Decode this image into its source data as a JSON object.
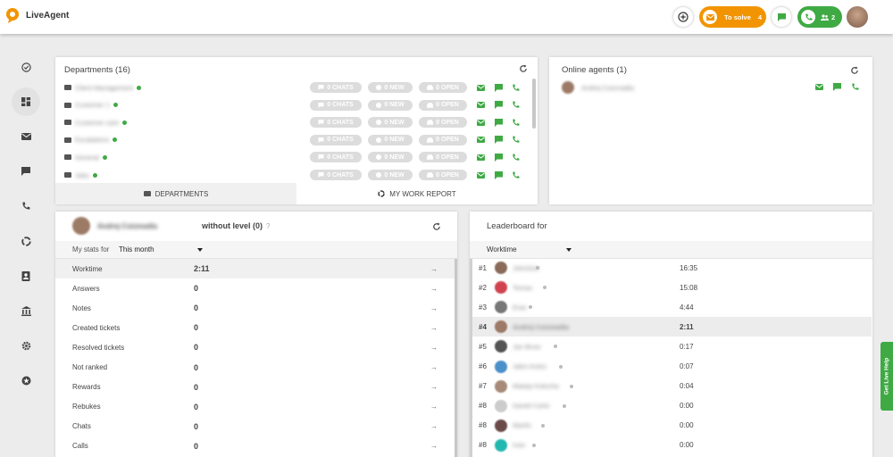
{
  "app": {
    "logo_text": "LiveAgent"
  },
  "topbar": {
    "to_solve_label": "To solve",
    "to_solve_count": "4",
    "calls_count": "2"
  },
  "colors": {
    "accent_orange": "#f29400",
    "accent_green": "#3faa44",
    "pill_gray": "#dcdcdc"
  },
  "sidebar": {
    "items": [
      {
        "icon": "check-circle-icon"
      },
      {
        "icon": "dashboard-icon",
        "active": true
      },
      {
        "icon": "mail-icon"
      },
      {
        "icon": "chat-icon"
      },
      {
        "icon": "phone-icon"
      },
      {
        "icon": "reports-icon"
      },
      {
        "icon": "contacts-icon"
      },
      {
        "icon": "bank-icon"
      },
      {
        "icon": "settings-icon"
      },
      {
        "icon": "plugins-icon"
      }
    ]
  },
  "departments": {
    "title": "Departments (16)",
    "rows": [
      {
        "name": "Client Management",
        "chats": "0 CHATS",
        "new": "0 NEW",
        "open": "0 OPEN"
      },
      {
        "name": "Customer 1",
        "chats": "0 CHATS",
        "new": "0 NEW",
        "open": "0 OPEN"
      },
      {
        "name": "Customer care",
        "chats": "0 CHATS",
        "new": "0 NEW",
        "open": "0 OPEN"
      },
      {
        "name": "Escalations",
        "chats": "0 CHATS",
        "new": "0 NEW",
        "open": "0 OPEN"
      },
      {
        "name": "General",
        "chats": "0 CHATS",
        "new": "0 NEW",
        "open": "0 OPEN"
      },
      {
        "name": "Jobs",
        "chats": "0 CHATS",
        "new": "0 NEW",
        "open": "0 OPEN"
      }
    ],
    "tab_departments": "DEPARTMENTS",
    "tab_report": "MY WORK REPORT"
  },
  "online_agents": {
    "title": "Online agents (1)",
    "agents": [
      {
        "name": "Andrej Csizmadia"
      }
    ]
  },
  "my_stats": {
    "agent_name": "Andrej Csizmadia",
    "level": "without level (0)",
    "help": "?",
    "stats_for_label": "My stats for",
    "period": "This month",
    "rows": [
      {
        "label": "Worktime",
        "value": "2:11",
        "highlight": true
      },
      {
        "label": "Answers",
        "value": "0"
      },
      {
        "label": "Notes",
        "value": "0"
      },
      {
        "label": "Created tickets",
        "value": "0"
      },
      {
        "label": "Resolved tickets",
        "value": "0"
      },
      {
        "label": "Not ranked",
        "value": "0"
      },
      {
        "label": "Rewards",
        "value": "0"
      },
      {
        "label": "Rebukes",
        "value": "0"
      },
      {
        "label": "Chats",
        "value": "0"
      },
      {
        "label": "Calls",
        "value": "0"
      }
    ],
    "arrow": "→"
  },
  "leaderboard": {
    "title": "Leaderboard for",
    "metric": "Worktime",
    "rows": [
      {
        "rank": "#1",
        "name": "JohnDoe",
        "time": "16:35",
        "avatar": "#8a6b5a"
      },
      {
        "rank": "#2",
        "name": "Tomas",
        "time": "15:08",
        "avatar": "#d0444f"
      },
      {
        "rank": "#3",
        "name": "Eran",
        "time": "4:44",
        "avatar": "#777777"
      },
      {
        "rank": "#4",
        "name": "Andrej Csizmadia",
        "time": "2:11",
        "avatar": "#9c7a66",
        "highlight": true
      },
      {
        "rank": "#5",
        "name": "Jan Brow",
        "time": "0:17",
        "avatar": "#555555"
      },
      {
        "rank": "#6",
        "name": "Jakis Kolos",
        "time": "0:07",
        "avatar": "#4a90c9"
      },
      {
        "rank": "#7",
        "name": "Mateja Kolucha",
        "time": "0:04",
        "avatar": "#a88a78"
      },
      {
        "rank": "#8",
        "name": "Daniel Carlo",
        "time": "0:00",
        "avatar": "#cccccc"
      },
      {
        "rank": "#8",
        "name": "Martin",
        "time": "0:00",
        "avatar": "#6b4a4a"
      },
      {
        "rank": "#8",
        "name": "Ivan",
        "time": "0:00",
        "avatar": "#22b8b0"
      }
    ]
  },
  "live_help": "Get Live Help"
}
